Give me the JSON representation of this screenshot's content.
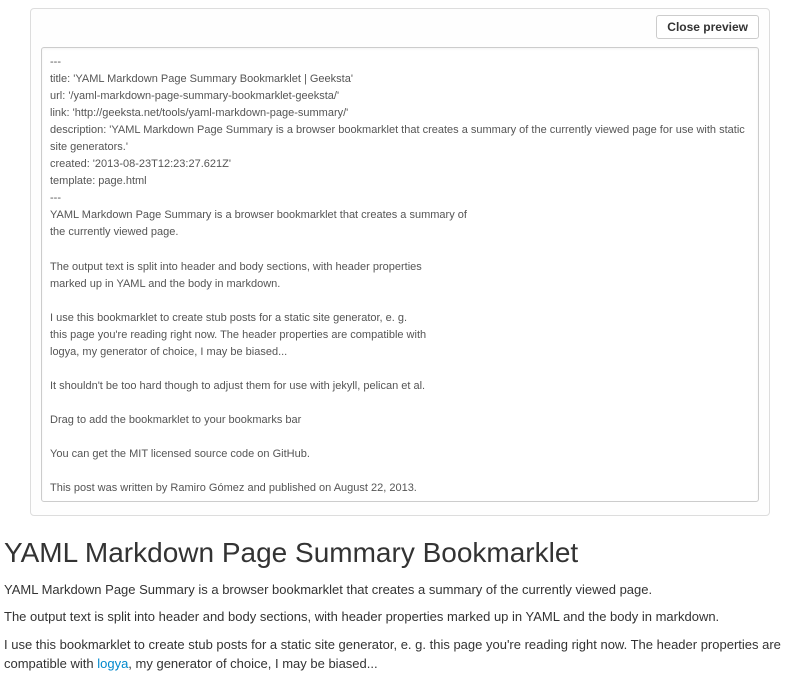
{
  "preview": {
    "close_label": "Close preview",
    "content": "---\ntitle: 'YAML Markdown Page Summary Bookmarklet | Geeksta'\nurl: '/yaml-markdown-page-summary-bookmarklet-geeksta/'\nlink: 'http://geeksta.net/tools/yaml-markdown-page-summary/'\ndescription: 'YAML Markdown Page Summary is a browser bookmarklet that creates a summary of the currently viewed page for use with static site generators.'\ncreated: '2013-08-23T12:23:27.621Z'\ntemplate: page.html\n---\nYAML Markdown Page Summary is a browser bookmarklet that creates a summary of\nthe currently viewed page.\n\nThe output text is split into header and body sections, with header properties\nmarked up in YAML and the body in markdown.\n\nI use this bookmarklet to create stub posts for a static site generator, e. g.\nthis page you're reading right now. The header properties are compatible with\nlogya, my generator of choice, I may be biased...\n\nIt shouldn't be too hard though to adjust them for use with jekyll, pelican et al.\n\nDrag to add the bookmarklet to your bookmarks bar\n\nYou can get the MIT licensed source code on GitHub.\n\nThis post was written by Ramiro Gómez and published on August 22, 2013.\n\nRamiro is a developer who likes open source, data mining, visualization, and writing. To learn more about him and this site, see the about page.\n\nGeeksta.net: programming, data mining, data visualization, tech books, and tools for tech geeks."
  },
  "article": {
    "heading": "YAML Markdown Page Summary Bookmarklet",
    "p1": "YAML Markdown Page Summary is a browser bookmarklet that creates a summary of the currently viewed page.",
    "p2": "The output text is split into header and body sections, with header properties marked up in YAML and the body in markdown.",
    "p3_a": "I use this bookmarklet to create stub posts for a static site generator, e. g. this page you're reading right now. The header properties are compatible with ",
    "p3_link": "logya",
    "p3_b": ", my generator of choice, I may be biased..."
  }
}
